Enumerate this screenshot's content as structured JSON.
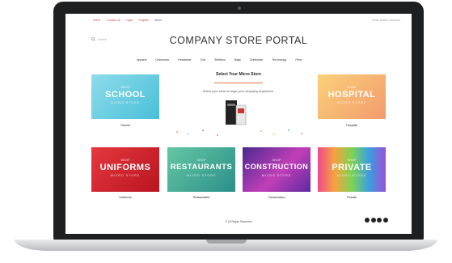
{
  "topbar": {
    "links": [
      "Home",
      "Contact Us",
      "Login",
      "Register",
      "Menu"
    ],
    "right_text": "Order Status / Account"
  },
  "search": {
    "label": "Search"
  },
  "header": {
    "title": "COMPANY STORE PORTAL"
  },
  "nav": {
    "items": [
      "Apparel",
      "Outerwear",
      "Headwear",
      "Golf",
      "Athletics",
      "Bags",
      "Drinkware",
      "Technology",
      "Pens"
    ]
  },
  "main": {
    "subtitle": "Select Your Micro Store",
    "tagline": "Select your store to begin your shopping experience."
  },
  "tiles": [
    {
      "shop": "SHOP",
      "name": "SCHOOL",
      "micro": "MICRO STORE",
      "caption": "School"
    },
    {
      "shop": "SHOP",
      "name": "HOSPITAL",
      "micro": "MICRO STORE",
      "caption": "Hospital"
    },
    {
      "shop": "SHOP",
      "name": "UNIFORMS",
      "micro": "MICRO STORE",
      "caption": "Uniforms"
    },
    {
      "shop": "SHOP",
      "name": "RESTAURANTS",
      "micro": "MICRO STORE",
      "caption": "Restaurants"
    },
    {
      "shop": "SHOP",
      "name": "CONSTRUCTION",
      "micro": "MICRO STORE",
      "caption": "Construction"
    },
    {
      "shop": "SHOP",
      "name": "PRIVATE",
      "micro": "MICRO STORE",
      "caption": "Private"
    }
  ],
  "footer": {
    "copyright": "© All Rights Reserved"
  },
  "colors": {
    "accent": "#e07a3c",
    "link": "#c0504d"
  }
}
